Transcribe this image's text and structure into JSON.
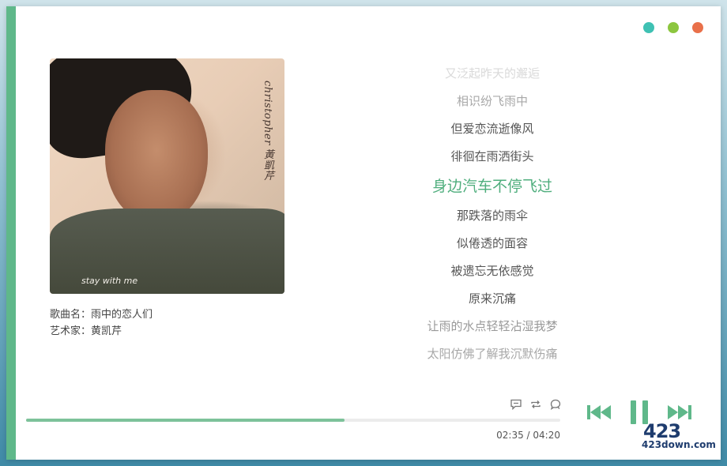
{
  "window_controls": [
    {
      "name": "minimize",
      "color": "#3fc1b3"
    },
    {
      "name": "maximize",
      "color": "#8cc63f"
    },
    {
      "name": "close",
      "color": "#e9704a"
    }
  ],
  "accent_color": "#5fb88a",
  "album": {
    "cover_title": "christopher 黃凱芹",
    "cover_subtitle": "stay with me"
  },
  "song": {
    "title_label": "歌曲名：",
    "title": "雨中的恋人们",
    "artist_label": "艺术家：",
    "artist": "黄凯芹"
  },
  "lyrics": {
    "lines": [
      "又泛起昨天的邂逅",
      "相识纷飞雨中",
      "但爱恋流逝像风",
      "徘徊在雨洒街头",
      "身边汽车不停飞过",
      "那跌落的雨伞",
      "似倦透的面容",
      "被遗忘无依感觉",
      "原来沉痛",
      "让雨的水点轻轻沾湿我梦",
      "太阳仿佛了解我沉默伤痛"
    ],
    "current_index": 4
  },
  "actions": [
    {
      "name": "comment-icon",
      "glyph": "💬"
    },
    {
      "name": "repeat-icon",
      "glyph": "⟲"
    },
    {
      "name": "share-icon",
      "glyph": "↻"
    }
  ],
  "playback": {
    "elapsed": "02:35",
    "total": "04:20",
    "separator": " / ",
    "progress_fraction": 0.596
  },
  "watermark": {
    "top": "423",
    "bottom": "423down.com"
  }
}
